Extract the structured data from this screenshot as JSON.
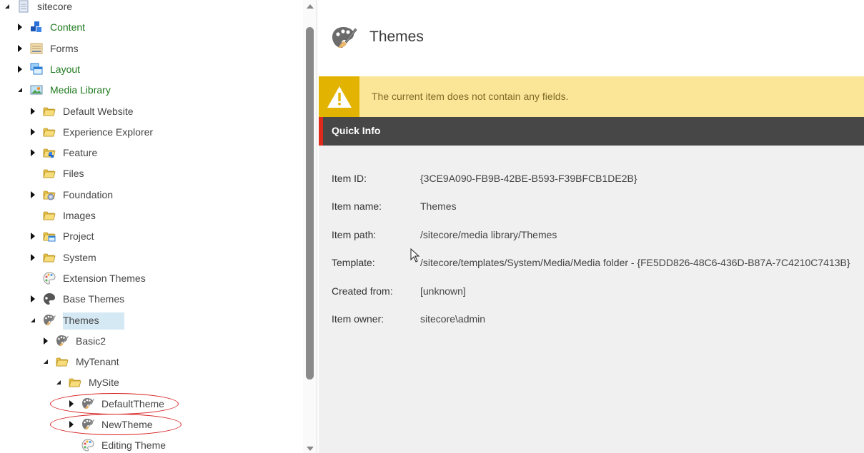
{
  "tree": {
    "items": [
      {
        "label": "sitecore",
        "icon": "document-icon",
        "state": "expanded",
        "level": 0
      },
      {
        "label": "Content",
        "icon": "cubes-icon",
        "state": "collapsed",
        "level": 1,
        "green": true
      },
      {
        "label": "Forms",
        "icon": "form-icon",
        "state": "collapsed",
        "level": 1
      },
      {
        "label": "Layout",
        "icon": "layout-windows-icon",
        "state": "collapsed",
        "level": 1,
        "green": true
      },
      {
        "label": "Media Library",
        "icon": "image-icon",
        "state": "expanded",
        "level": 1,
        "green": true
      },
      {
        "label": "Default Website",
        "icon": "folder-icon",
        "state": "collapsed",
        "level": 2
      },
      {
        "label": "Experience Explorer",
        "icon": "folder-icon",
        "state": "collapsed",
        "level": 2
      },
      {
        "label": "Feature",
        "icon": "folder-cubes-icon",
        "state": "collapsed",
        "level": 2
      },
      {
        "label": "Files",
        "icon": "folder-icon",
        "state": "leaf",
        "level": 2
      },
      {
        "label": "Foundation",
        "icon": "folder-gear-icon",
        "state": "collapsed",
        "level": 2
      },
      {
        "label": "Images",
        "icon": "folder-icon",
        "state": "leaf",
        "level": 2
      },
      {
        "label": "Project",
        "icon": "folder-window-icon",
        "state": "collapsed",
        "level": 2
      },
      {
        "label": "System",
        "icon": "folder-icon",
        "state": "collapsed",
        "level": 2
      },
      {
        "label": "Extension Themes",
        "icon": "palette-color-icon",
        "state": "leaf",
        "level": 2
      },
      {
        "label": "Base Themes",
        "icon": "palette-dark-icon",
        "state": "collapsed",
        "level": 2
      },
      {
        "label": "Themes",
        "icon": "palette-brush-icon",
        "state": "expanded",
        "level": 2,
        "selected": true
      },
      {
        "label": "Basic2",
        "icon": "palette-brush-icon",
        "state": "collapsed",
        "level": 3
      },
      {
        "label": "MyTenant",
        "icon": "folder-icon",
        "state": "expanded",
        "level": 3
      },
      {
        "label": "MySite",
        "icon": "folder-icon",
        "state": "expanded",
        "level": 4
      },
      {
        "label": "DefaultTheme",
        "icon": "palette-brush-icon",
        "state": "collapsed",
        "level": 5,
        "highlighted": true
      },
      {
        "label": "NewTheme",
        "icon": "palette-brush-icon",
        "state": "collapsed",
        "level": 5,
        "highlighted": true
      },
      {
        "label": "Editing Theme",
        "icon": "palette-color-icon",
        "state": "leaf",
        "level": 5
      }
    ]
  },
  "header": {
    "title": "Themes",
    "icon": "palette-brush-icon"
  },
  "warning": {
    "icon": "warning-icon",
    "text": "The current item does not contain any fields."
  },
  "quick_info": {
    "title": "Quick Info",
    "rows": [
      {
        "label": "Item ID:",
        "value": "{3CE9A090-FB9B-42BE-B593-F39BFCB1DE2B}"
      },
      {
        "label": "Item name:",
        "value": "Themes"
      },
      {
        "label": "Item path:",
        "value": "/sitecore/media library/Themes"
      },
      {
        "label": "Template:",
        "value": "/sitecore/templates/System/Media/Media folder - {FE5DD826-48C6-436D-B87A-7C4210C7413B}"
      },
      {
        "label": "Created from:",
        "value": "[unknown]"
      },
      {
        "label": "Item owner:",
        "value": "sitecore\\admin"
      }
    ]
  },
  "colors": {
    "accent_red": "#dd2a1b",
    "warning_bg": "#fbe698",
    "warning_icon_bg": "#e2b300",
    "quickinfo_bg": "#474747",
    "selected_bg": "#d5e9f5",
    "green_label": "#1f7a1f"
  }
}
